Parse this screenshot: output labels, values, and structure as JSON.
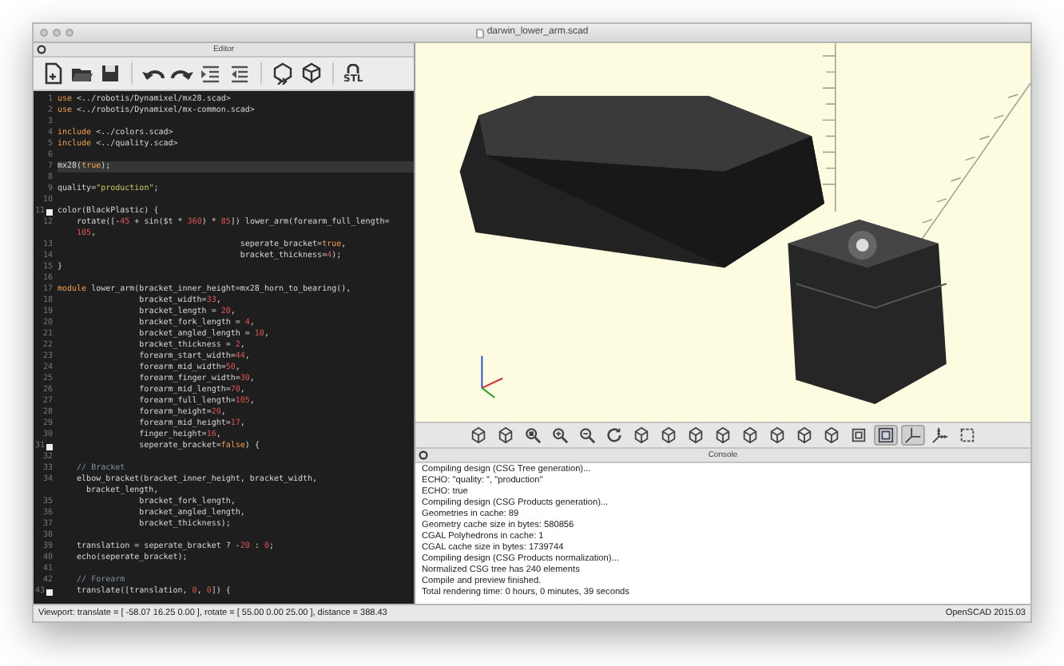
{
  "window": {
    "title": "darwin_lower_arm.scad"
  },
  "editor": {
    "title": "Editor",
    "stl_label": "STL",
    "lines": [
      {
        "num": "1",
        "fold": false,
        "current": false,
        "tokens": [
          {
            "kind": "keyword",
            "text": "use"
          },
          {
            "kind": "plain",
            "text": " <../robotis/Dynamixel/mx28.scad>"
          }
        ]
      },
      {
        "num": "2",
        "fold": false,
        "current": false,
        "tokens": [
          {
            "kind": "keyword",
            "text": "use"
          },
          {
            "kind": "plain",
            "text": " <../robotis/Dynamixel/mx-common.scad>"
          }
        ]
      },
      {
        "num": "3",
        "fold": false,
        "current": false
      },
      {
        "num": "4",
        "fold": false,
        "current": false,
        "tokens": [
          {
            "kind": "keyword",
            "text": "include"
          },
          {
            "kind": "plain",
            "text": " <../colors.scad>"
          }
        ]
      },
      {
        "num": "5",
        "fold": false,
        "current": false,
        "tokens": [
          {
            "kind": "keyword",
            "text": "include"
          },
          {
            "kind": "plain",
            "text": " <../quality.scad>"
          }
        ]
      },
      {
        "num": "6",
        "fold": false,
        "current": false
      },
      {
        "num": "7",
        "fold": false,
        "current": true,
        "tokens": [
          {
            "kind": "plain",
            "text": "mx28("
          },
          {
            "kind": "keyword",
            "text": "true"
          },
          {
            "kind": "plain",
            "text": ");"
          }
        ]
      },
      {
        "num": "8",
        "fold": false,
        "current": false
      },
      {
        "num": "9",
        "fold": false,
        "current": false,
        "tokens": [
          {
            "kind": "plain",
            "text": "quality="
          },
          {
            "kind": "string",
            "text": "\"production\""
          },
          {
            "kind": "plain",
            "text": ";"
          }
        ]
      },
      {
        "num": "10",
        "fold": false,
        "current": false
      },
      {
        "num": "11",
        "fold": true,
        "current": false,
        "tokens": [
          {
            "kind": "plain",
            "text": "color(BlackPlastic) {"
          }
        ]
      },
      {
        "num": "12",
        "fold": false,
        "current": false,
        "tokens": [
          {
            "kind": "plain",
            "text": "    rotate([-"
          },
          {
            "kind": "number",
            "text": "45"
          },
          {
            "kind": "plain",
            "text": " + sin($t * "
          },
          {
            "kind": "number",
            "text": "360"
          },
          {
            "kind": "plain",
            "text": ") * "
          },
          {
            "kind": "number",
            "text": "85"
          },
          {
            "kind": "plain",
            "text": "]) lower_arm(forearm_full_length="
          }
        ]
      },
      {
        "fold": false,
        "current": false,
        "tokens": [
          {
            "kind": "number",
            "text": "105"
          },
          {
            "kind": "plain",
            "text": ","
          }
        ]
      },
      {
        "num": "13",
        "fold": false,
        "current": false,
        "tokens": [
          {
            "kind": "plain",
            "text": "                                      seperate_bracket="
          },
          {
            "kind": "keyword",
            "text": "true"
          },
          {
            "kind": "plain",
            "text": ","
          }
        ]
      },
      {
        "num": "14",
        "fold": false,
        "current": false,
        "tokens": [
          {
            "kind": "plain",
            "text": "                                      bracket_thickness="
          },
          {
            "kind": "number",
            "text": "4"
          },
          {
            "kind": "plain",
            "text": ");"
          }
        ]
      },
      {
        "num": "15",
        "fold": false,
        "current": false,
        "tokens": [
          {
            "kind": "plain",
            "text": "}"
          }
        ]
      },
      {
        "num": "16",
        "fold": false,
        "current": false
      },
      {
        "num": "17",
        "fold": false,
        "current": false,
        "tokens": [
          {
            "kind": "keyword",
            "text": "module"
          },
          {
            "kind": "plain",
            "text": " lower_arm(bracket_inner_height=mx28_horn_to_bearing(),"
          }
        ]
      },
      {
        "num": "18",
        "fold": false,
        "current": false,
        "tokens": [
          {
            "kind": "plain",
            "text": "                 bracket_width="
          },
          {
            "kind": "number",
            "text": "33"
          },
          {
            "kind": "plain",
            "text": ","
          }
        ]
      },
      {
        "num": "19",
        "fold": false,
        "current": false,
        "tokens": [
          {
            "kind": "plain",
            "text": "                 bracket_length = "
          },
          {
            "kind": "number",
            "text": "20"
          },
          {
            "kind": "plain",
            "text": ","
          }
        ]
      },
      {
        "num": "20",
        "fold": false,
        "current": false,
        "tokens": [
          {
            "kind": "plain",
            "text": "                 bracket_fork_length = "
          },
          {
            "kind": "number",
            "text": "4"
          },
          {
            "kind": "plain",
            "text": ","
          }
        ]
      },
      {
        "num": "21",
        "fold": false,
        "current": false,
        "tokens": [
          {
            "kind": "plain",
            "text": "                 bracket_angled_length = "
          },
          {
            "kind": "number",
            "text": "10"
          },
          {
            "kind": "plain",
            "text": ","
          }
        ]
      },
      {
        "num": "22",
        "fold": false,
        "current": false,
        "tokens": [
          {
            "kind": "plain",
            "text": "                 bracket_thickness = "
          },
          {
            "kind": "number",
            "text": "2"
          },
          {
            "kind": "plain",
            "text": ","
          }
        ]
      },
      {
        "num": "23",
        "fold": false,
        "current": false,
        "tokens": [
          {
            "kind": "plain",
            "text": "                 forearm_start_width="
          },
          {
            "kind": "number",
            "text": "44"
          },
          {
            "kind": "plain",
            "text": ","
          }
        ]
      },
      {
        "num": "24",
        "fold": false,
        "current": false,
        "tokens": [
          {
            "kind": "plain",
            "text": "                 forearm_mid_width="
          },
          {
            "kind": "number",
            "text": "50"
          },
          {
            "kind": "plain",
            "text": ","
          }
        ]
      },
      {
        "num": "25",
        "fold": false,
        "current": false,
        "tokens": [
          {
            "kind": "plain",
            "text": "                 forearm_finger_width="
          },
          {
            "kind": "number",
            "text": "30"
          },
          {
            "kind": "plain",
            "text": ","
          }
        ]
      },
      {
        "num": "26",
        "fold": false,
        "current": false,
        "tokens": [
          {
            "kind": "plain",
            "text": "                 forearm_mid_length="
          },
          {
            "kind": "number",
            "text": "70"
          },
          {
            "kind": "plain",
            "text": ","
          }
        ]
      },
      {
        "num": "27",
        "fold": false,
        "current": false,
        "tokens": [
          {
            "kind": "plain",
            "text": "                 forearm_full_length="
          },
          {
            "kind": "number",
            "text": "105"
          },
          {
            "kind": "plain",
            "text": ","
          }
        ]
      },
      {
        "num": "28",
        "fold": false,
        "current": false,
        "tokens": [
          {
            "kind": "plain",
            "text": "                 forearm_height="
          },
          {
            "kind": "number",
            "text": "20"
          },
          {
            "kind": "plain",
            "text": ","
          }
        ]
      },
      {
        "num": "29",
        "fold": false,
        "current": false,
        "tokens": [
          {
            "kind": "plain",
            "text": "                 forearm_mid_height="
          },
          {
            "kind": "number",
            "text": "17"
          },
          {
            "kind": "plain",
            "text": ","
          }
        ]
      },
      {
        "num": "30",
        "fold": false,
        "current": false,
        "tokens": [
          {
            "kind": "plain",
            "text": "                 finger_height="
          },
          {
            "kind": "number",
            "text": "16"
          },
          {
            "kind": "plain",
            "text": ","
          }
        ]
      },
      {
        "num": "31",
        "fold": true,
        "current": false,
        "tokens": [
          {
            "kind": "plain",
            "text": "                 seperate_bracket="
          },
          {
            "kind": "keyword",
            "text": "false"
          },
          {
            "kind": "plain",
            "text": ") {"
          }
        ]
      },
      {
        "num": "32",
        "fold": false,
        "current": false
      },
      {
        "num": "33",
        "fold": false,
        "current": false,
        "tokens": [
          {
            "kind": "comment",
            "text": "    // Bracket"
          }
        ]
      },
      {
        "num": "34",
        "fold": false,
        "current": false,
        "tokens": [
          {
            "kind": "plain",
            "text": "    elbow_bracket(bracket_inner_height, bracket_width,"
          }
        ]
      },
      {
        "fold": false,
        "current": false,
        "tokens": [
          {
            "kind": "plain",
            "text": "  bracket_length,"
          }
        ]
      },
      {
        "num": "35",
        "fold": false,
        "current": false,
        "tokens": [
          {
            "kind": "plain",
            "text": "                 bracket_fork_length,"
          }
        ]
      },
      {
        "num": "36",
        "fold": false,
        "current": false,
        "tokens": [
          {
            "kind": "plain",
            "text": "                 bracket_angled_length,"
          }
        ]
      },
      {
        "num": "37",
        "fold": false,
        "current": false,
        "tokens": [
          {
            "kind": "plain",
            "text": "                 bracket_thickness);"
          }
        ]
      },
      {
        "num": "38",
        "fold": false,
        "current": false
      },
      {
        "num": "39",
        "fold": false,
        "current": false,
        "tokens": [
          {
            "kind": "plain",
            "text": "    translation = seperate_bracket ? -"
          },
          {
            "kind": "number",
            "text": "20"
          },
          {
            "kind": "plain",
            "text": " : "
          },
          {
            "kind": "number",
            "text": "0"
          },
          {
            "kind": "plain",
            "text": ";"
          }
        ]
      },
      {
        "num": "40",
        "fold": false,
        "current": false,
        "tokens": [
          {
            "kind": "plain",
            "text": "    echo(seperate_bracket);"
          }
        ]
      },
      {
        "num": "41",
        "fold": false,
        "current": false
      },
      {
        "num": "42",
        "fold": false,
        "current": false,
        "tokens": [
          {
            "kind": "comment",
            "text": "    // Forearm"
          }
        ]
      },
      {
        "num": "43",
        "fold": true,
        "current": false,
        "tokens": [
          {
            "kind": "plain",
            "text": "    translate([translation, "
          },
          {
            "kind": "number",
            "text": "0"
          },
          {
            "kind": "plain",
            "text": ", "
          },
          {
            "kind": "number",
            "text": "0"
          },
          {
            "kind": "plain",
            "text": "]) {"
          }
        ]
      }
    ]
  },
  "console": {
    "title": "Console",
    "lines": [
      "Compiling design (CSG Tree generation)...",
      "ECHO: \"quality: \", \"production\"",
      "ECHO: true",
      "Compiling design (CSG Products generation)...",
      "Geometries in cache: 89",
      "Geometry cache size in bytes: 580856",
      "CGAL Polyhedrons in cache: 1",
      "CGAL cache size in bytes: 1739744",
      "Compiling design (CSG Products normalization)...",
      "Normalized CSG tree has 240 elements",
      "Compile and preview finished.",
      "Total rendering time: 0 hours, 0 minutes, 39 seconds"
    ]
  },
  "status_bar": {
    "viewport": "Viewport: translate = [ -58.07 16.25 0.00 ], rotate = [ 55.00 0.00 25.00 ], distance = 388.43",
    "version": "OpenSCAD 2015.03"
  }
}
